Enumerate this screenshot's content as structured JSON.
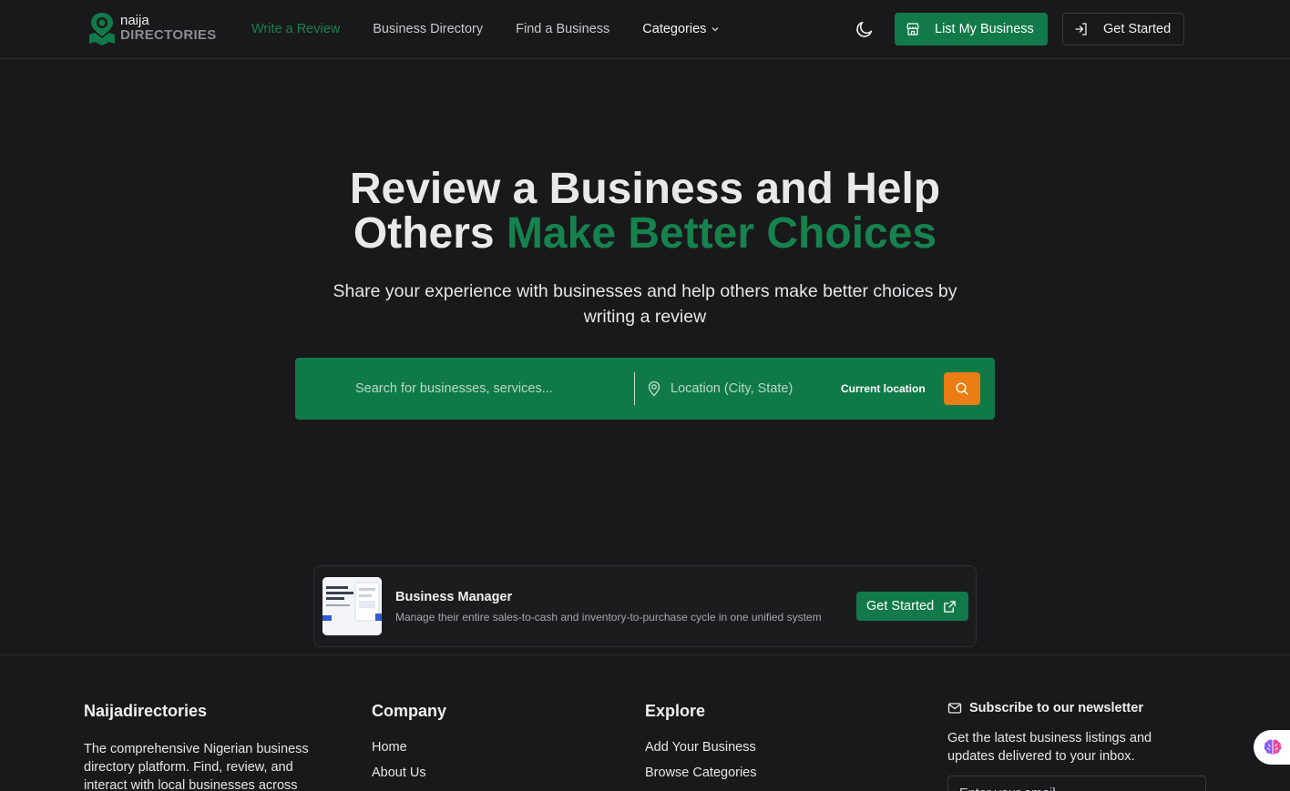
{
  "brand": {
    "name_top": "naija",
    "name_bottom": "DIRECTORIES",
    "accent_color": "#127a4a"
  },
  "nav": {
    "items": [
      "Write a Review",
      "Business Directory",
      "Find a Business"
    ],
    "categories_label": "Categories",
    "theme_icon": "moon-icon",
    "list_business_label": "List My Business",
    "get_started_label": "Get Started"
  },
  "hero": {
    "title_part1": "Review a Business and Help",
    "title_part2": "Others ",
    "title_accent": "Make Better Choices",
    "subtitle": "Share your experience with businesses and help others make better choices by writing a review"
  },
  "search": {
    "query_placeholder": "Search for businesses, services...",
    "location_placeholder": "Location (City, State)",
    "current_location_label": "Current location",
    "button_color": "#ea7e14"
  },
  "ad": {
    "title": "Business Manager",
    "description": "Manage their entire sales-to-cash and inventory-to-purchase cycle in one unified system",
    "button_label": "Get Started"
  },
  "footer": {
    "about": {
      "heading": "Naijadirectories",
      "text": "The comprehensive Nigerian business directory platform. Find, review, and interact with local businesses across"
    },
    "company": {
      "heading": "Company",
      "links": [
        "Home",
        "About Us"
      ]
    },
    "explore": {
      "heading": "Explore",
      "links": [
        "Add Your Business",
        "Browse Categories"
      ]
    },
    "newsletter": {
      "heading": "Subscribe to our newsletter",
      "text": "Get the latest business listings and updates delivered to your inbox.",
      "email_placeholder": "Enter your email"
    }
  }
}
